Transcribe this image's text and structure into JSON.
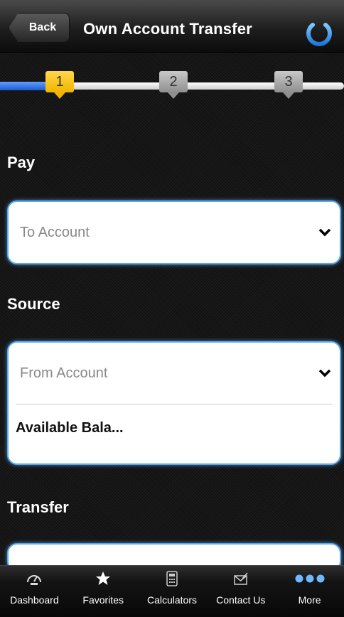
{
  "header": {
    "back_label": "Back",
    "title": "Own Account Transfer",
    "power_icon": "power-icon"
  },
  "steps": [
    {
      "label": "1",
      "state": "active"
    },
    {
      "label": "2",
      "state": "inactive"
    },
    {
      "label": "3",
      "state": "inactive"
    }
  ],
  "pay": {
    "label": "Pay",
    "select_value": "To Account"
  },
  "source": {
    "label": "Source",
    "select_value": "From Account",
    "balance_label": "Available Bala..."
  },
  "transfer": {
    "label": "Transfer"
  },
  "tabbar": {
    "items": [
      {
        "label": "Dashboard",
        "icon": "gauge-icon"
      },
      {
        "label": "Favorites",
        "icon": "star-icon"
      },
      {
        "label": "Calculators",
        "icon": "calculator-icon"
      },
      {
        "label": "Contact Us",
        "icon": "envelope-icon"
      },
      {
        "label": "More",
        "icon": "more-dots-icon"
      }
    ]
  },
  "colors": {
    "accent_blue": "#58a8ec",
    "step_active": "#f2b400",
    "progress_blue": "#1e5bd0"
  }
}
